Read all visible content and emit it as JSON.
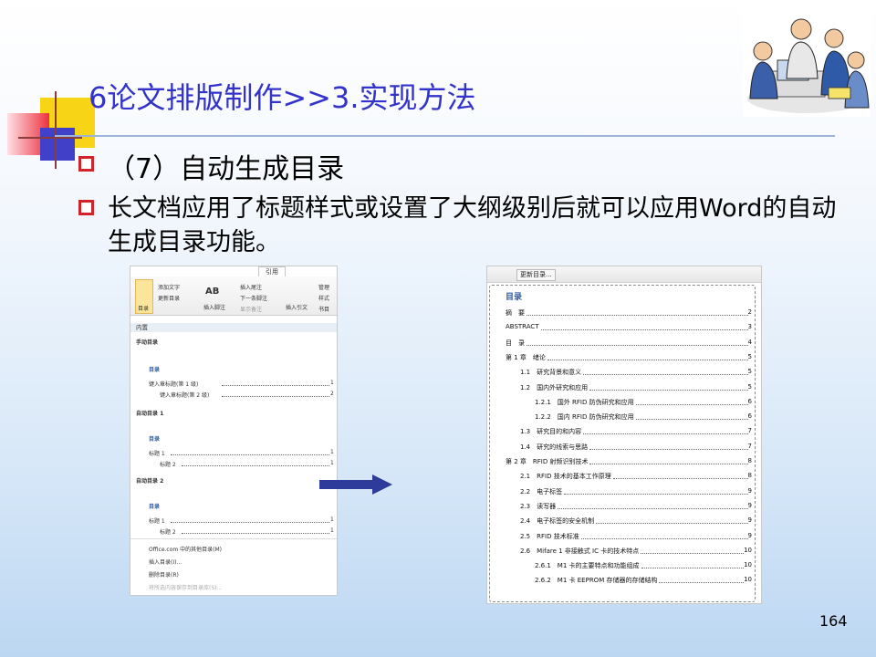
{
  "slide": {
    "title": "6论文排版制作>>3.实现方法",
    "points": [
      "（7）自动生成目录",
      "长文档应用了标题样式或设置了大纲级别后就可以应用Word的自动生成目录功能。"
    ],
    "page_number": "164"
  },
  "left_shot": {
    "tab": "引用",
    "ribbon": {
      "toc_label": "目录",
      "add_text": "添加文字",
      "update_toc": "更新目录",
      "insert_footnote": "插入脚注",
      "insert_endnote": "插入尾注",
      "next_footnote": "下一条脚注",
      "show_notes": "显示备注",
      "insert_citation": "插入引文",
      "manage": "管理",
      "style": "样式",
      "bibliography": "书目"
    },
    "builtin": "内置",
    "manual": "手动目录",
    "auto1": "自动目录 1",
    "auto2": "自动目录 2",
    "toc_word": "目录",
    "manual_line1": "键入章标题(第 1 级)",
    "manual_line2": "键入章标题(第 2 级)",
    "heading1": "标题 1",
    "heading2": "标题 2",
    "num1": "1",
    "num2": "2",
    "menu": [
      "Office.com 中的其他目录(M)",
      "插入目录(I)...",
      "删除目录(R)",
      "将所选内容保存到目录库(S)..."
    ]
  },
  "right_shot": {
    "update_btn": "更新目录...",
    "title": "目录",
    "entries": [
      {
        "label": "摘　要",
        "page": "2",
        "level": 1
      },
      {
        "label": "ABSTRACT",
        "page": "3",
        "level": 1
      },
      {
        "label": "目　录",
        "page": "4",
        "level": 1
      },
      {
        "label": "第 1 章　绪论",
        "page": "5",
        "level": 1
      },
      {
        "label": "1.1　研究背景和意义",
        "page": "5",
        "level": 2
      },
      {
        "label": "1.2　国内外研究和应用",
        "page": "5",
        "level": 2
      },
      {
        "label": "1.2.1　国外 RFID 防伪研究和应用",
        "page": "6",
        "level": 3
      },
      {
        "label": "1.2.2　国内 RFID 防伪研究和应用",
        "page": "6",
        "level": 3
      },
      {
        "label": "1.3　研究目的和内容",
        "page": "7",
        "level": 2
      },
      {
        "label": "1.4　研究的线索与思路",
        "page": "7",
        "level": 2
      },
      {
        "label": "第 2 章　RFID 射频识别技术",
        "page": "8",
        "level": 1
      },
      {
        "label": "2.1　RFID 技术的基本工作原理",
        "page": "8",
        "level": 2
      },
      {
        "label": "2.2　电子标签",
        "page": "9",
        "level": 2
      },
      {
        "label": "2.3　读写器",
        "page": "9",
        "level": 2
      },
      {
        "label": "2.4　电子标签的安全机制",
        "page": "9",
        "level": 2
      },
      {
        "label": "2.5　RFID 技术标准",
        "page": "9",
        "level": 2
      },
      {
        "label": "2.6　Mifare 1 非接触式 IC 卡的技术特点",
        "page": "10",
        "level": 2
      },
      {
        "label": "2.6.1　M1 卡的主要特点和功能组成",
        "page": "10",
        "level": 3
      },
      {
        "label": "2.6.2　M1 卡 EEPROM 存储器的存储结构",
        "page": "10",
        "level": 3
      }
    ]
  },
  "colors": {
    "title": "#3333cc",
    "bullet": "#d1232a",
    "arrow": "#2e3b9a"
  }
}
